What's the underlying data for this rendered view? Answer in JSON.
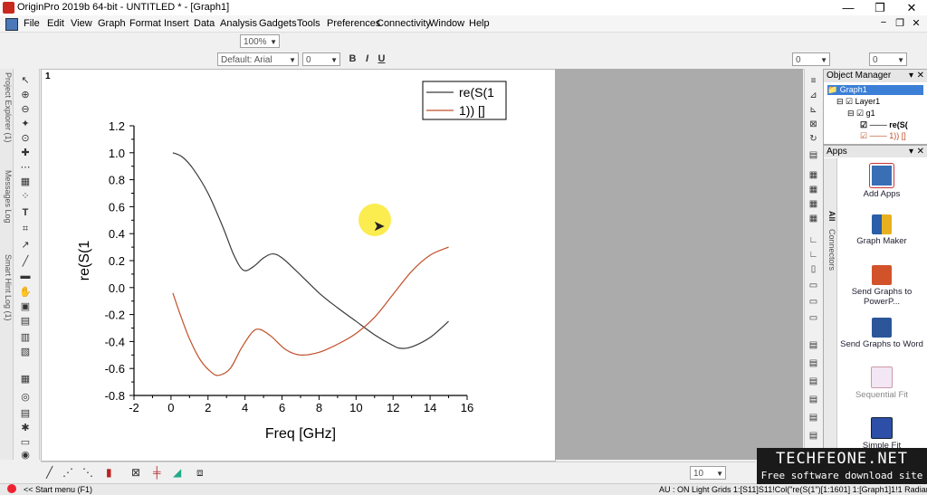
{
  "window": {
    "title": "OriginPro 2019b 64-bit - UNTITLED * - [Graph1]",
    "min": "—",
    "max": "❐",
    "close": "✕"
  },
  "menu": [
    "File",
    "Edit",
    "View",
    "Graph",
    "Format",
    "Insert",
    "Data",
    "Analysis",
    "Gadgets",
    "Tools",
    "Preferences",
    "Connectivity",
    "Window",
    "Help"
  ],
  "mdi": {
    "min": "−",
    "restore": "❐",
    "close": "✕"
  },
  "toolbar1": {
    "zoom": "100%"
  },
  "toolbar2": {
    "font": "Default: Arial",
    "size": "0"
  },
  "leftdock": [
    "Project Explorer (1)",
    "Messages Log",
    "Smart Hint Log (1)"
  ],
  "graph_tab": "1",
  "objmgr": {
    "title": "Object Manager",
    "items": [
      "Graph1",
      "Layer1",
      "g1",
      "re(S(",
      "1)) []"
    ]
  },
  "apps": {
    "title": "Apps",
    "tabs": [
      "All",
      "Connectors"
    ],
    "items": [
      {
        "label": "Add Apps"
      },
      {
        "label": "Graph Maker"
      },
      {
        "label": "Send Graphs to PowerP..."
      },
      {
        "label": "Send Graphs to Word"
      },
      {
        "label": "Sequential Fit"
      },
      {
        "label": "Simple Fit"
      }
    ]
  },
  "bottom": {
    "combo": "10"
  },
  "status": {
    "left": "<< Start menu (F1)",
    "right": "AU : ON  Light Grids  1:[S11]S11!Col(\"re(S(1\")[1:1601]  1:[Graph1]1!1  Radian"
  },
  "watermark": {
    "line1": "TECHFEONE.NET",
    "line2": "Free software download site"
  },
  "chart_data": {
    "type": "line",
    "title": "",
    "xlabel": "Freq [GHz]",
    "ylabel": "re(S(1",
    "xlim": [
      -2,
      16
    ],
    "ylim": [
      -0.8,
      1.2
    ],
    "xticks": [
      -2,
      0,
      2,
      4,
      6,
      8,
      10,
      12,
      14,
      16
    ],
    "yticks": [
      -0.8,
      -0.6,
      -0.4,
      -0.2,
      0.0,
      0.2,
      0.4,
      0.6,
      0.8,
      1.0,
      1.2
    ],
    "ytick_labels": [
      "-0.8",
      "-0.6",
      "-0.4",
      "-0.2",
      "0.0",
      "0.2",
      "0.4",
      "0.6",
      "0.8",
      "1.0",
      "1.2"
    ],
    "legend": [
      "re(S(1",
      "1)) []"
    ],
    "legend_position": "top-right",
    "series": [
      {
        "name": "re(S(1",
        "color": "#3a3a3a",
        "points": [
          [
            0.1,
            1.0
          ],
          [
            0.6,
            0.97
          ],
          [
            1.2,
            0.88
          ],
          [
            2.0,
            0.7
          ],
          [
            2.8,
            0.45
          ],
          [
            3.4,
            0.24
          ],
          [
            3.9,
            0.13
          ],
          [
            4.4,
            0.15
          ],
          [
            5.0,
            0.22
          ],
          [
            5.5,
            0.25
          ],
          [
            6.0,
            0.22
          ],
          [
            6.8,
            0.12
          ],
          [
            8.0,
            -0.04
          ],
          [
            9.0,
            -0.15
          ],
          [
            10.0,
            -0.25
          ],
          [
            11.0,
            -0.35
          ],
          [
            12.0,
            -0.43
          ],
          [
            12.4,
            -0.45
          ],
          [
            13.0,
            -0.44
          ],
          [
            14.0,
            -0.37
          ],
          [
            15.0,
            -0.25
          ]
        ]
      },
      {
        "name": "1)) []",
        "color": "#c0502a",
        "points": [
          [
            0.1,
            -0.04
          ],
          [
            0.5,
            -0.2
          ],
          [
            1.0,
            -0.38
          ],
          [
            1.6,
            -0.54
          ],
          [
            2.2,
            -0.63
          ],
          [
            2.6,
            -0.65
          ],
          [
            3.2,
            -0.6
          ],
          [
            3.8,
            -0.45
          ],
          [
            4.4,
            -0.33
          ],
          [
            4.8,
            -0.31
          ],
          [
            5.4,
            -0.36
          ],
          [
            6.2,
            -0.46
          ],
          [
            7.0,
            -0.5
          ],
          [
            8.0,
            -0.48
          ],
          [
            9.0,
            -0.42
          ],
          [
            10.0,
            -0.34
          ],
          [
            11.0,
            -0.22
          ],
          [
            12.0,
            -0.05
          ],
          [
            13.0,
            0.12
          ],
          [
            14.0,
            0.24
          ],
          [
            15.0,
            0.3
          ]
        ]
      }
    ]
  }
}
